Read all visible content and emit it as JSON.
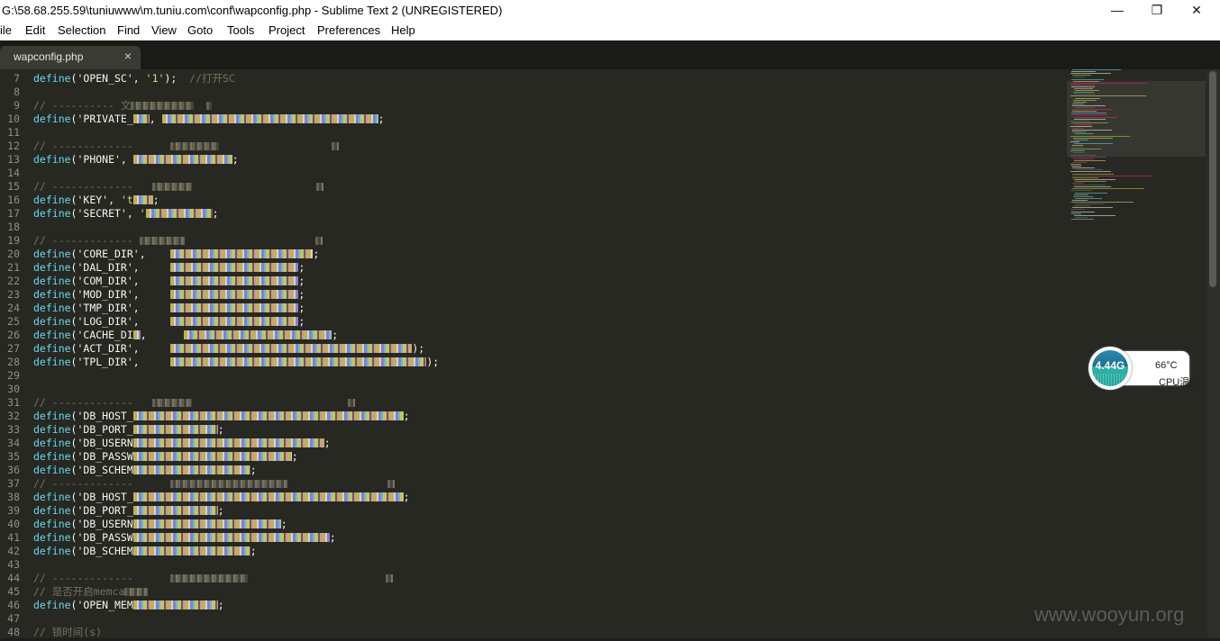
{
  "window": {
    "title": "G:\\58.68.255.59\\tuniuwww\\m.tuniu.com\\conf\\wapconfig.php - Sublime Text 2 (UNREGISTERED)",
    "minimize_icon": "minimize-icon",
    "maximize_icon": "restore-icon",
    "close_icon": "close-icon"
  },
  "menu": [
    "ile",
    "Edit",
    "Selection",
    "Find",
    "View",
    "Goto",
    "Tools",
    "Project",
    "Preferences",
    "Help"
  ],
  "tab": {
    "name": "wapconfig.php",
    "close": "×"
  },
  "lines": [
    {
      "n": "7",
      "parts": [
        [
          "kw",
          "define"
        ],
        [
          "pn",
          "('OPEN_SC'"
        ],
        [
          "pn",
          ", "
        ],
        [
          "st",
          "'1'"
        ],
        [
          "pn",
          ");  "
        ],
        [
          "cm",
          "//打开SC"
        ]
      ]
    },
    {
      "n": "8",
      "parts": []
    },
    {
      "n": "9",
      "parts": [
        [
          "cm",
          "// ---------- 文"
        ],
        [
          "dim",
          "70"
        ],
        [
          "cm",
          "  "
        ],
        [
          "dim",
          "6"
        ]
      ]
    },
    {
      "n": "10",
      "parts": [
        [
          "kw",
          "define"
        ],
        [
          "pn",
          "('PRIVATE_"
        ],
        [
          "blk",
          "18"
        ],
        [
          "pn",
          ", "
        ],
        [
          "blk",
          "240"
        ],
        [
          "pn",
          ";"
        ]
      ]
    },
    {
      "n": "11",
      "parts": []
    },
    {
      "n": "12",
      "parts": [
        [
          "cm",
          "// -------------      "
        ],
        [
          "dim",
          "54"
        ],
        [
          "cm",
          "                  "
        ],
        [
          "dim",
          "8"
        ]
      ]
    },
    {
      "n": "13",
      "parts": [
        [
          "kw",
          "define"
        ],
        [
          "pn",
          "('PHONE', "
        ],
        [
          "blk",
          "110"
        ],
        [
          "pn",
          ";"
        ]
      ]
    },
    {
      "n": "14",
      "parts": []
    },
    {
      "n": "15",
      "parts": [
        [
          "cm",
          "// -------------   "
        ],
        [
          "dim",
          "44"
        ],
        [
          "cm",
          "                    "
        ],
        [
          "dim",
          "8"
        ]
      ]
    },
    {
      "n": "16",
      "parts": [
        [
          "kw",
          "define"
        ],
        [
          "pn",
          "('KEY', "
        ],
        [
          "st",
          "'t"
        ],
        [
          "blk",
          "22"
        ],
        [
          "pn",
          ";"
        ]
      ]
    },
    {
      "n": "17",
      "parts": [
        [
          "kw",
          "define"
        ],
        [
          "pn",
          "('SECRET', "
        ],
        [
          "st",
          "'"
        ],
        [
          "blk",
          "74"
        ],
        [
          "pn",
          ";"
        ]
      ]
    },
    {
      "n": "18",
      "parts": []
    },
    {
      "n": "19",
      "parts": [
        [
          "cm",
          "// ------------- "
        ],
        [
          "dim",
          "50"
        ],
        [
          "cm",
          "                     "
        ],
        [
          "dim",
          "8"
        ]
      ]
    },
    {
      "n": "20",
      "parts": [
        [
          "kw",
          "define"
        ],
        [
          "pn",
          "('CORE_DIR'"
        ],
        [
          "pn",
          ",    "
        ],
        [
          "blk",
          "158"
        ],
        [
          "pn",
          ";"
        ]
      ]
    },
    {
      "n": "21",
      "parts": [
        [
          "kw",
          "define"
        ],
        [
          "pn",
          "('DAL_DIR'"
        ],
        [
          "pn",
          ",     "
        ],
        [
          "blk",
          "142"
        ],
        [
          "pn",
          ";"
        ]
      ]
    },
    {
      "n": "22",
      "parts": [
        [
          "kw",
          "define"
        ],
        [
          "pn",
          "('COM_DIR'"
        ],
        [
          "pn",
          ",     "
        ],
        [
          "blk",
          "142"
        ],
        [
          "pn",
          ";"
        ]
      ]
    },
    {
      "n": "23",
      "parts": [
        [
          "kw",
          "define"
        ],
        [
          "pn",
          "('MOD_DIR'"
        ],
        [
          "pn",
          ",     "
        ],
        [
          "blk",
          "142"
        ],
        [
          "pn",
          ";"
        ]
      ]
    },
    {
      "n": "24",
      "parts": [
        [
          "kw",
          "define"
        ],
        [
          "pn",
          "('TMP_DIR'"
        ],
        [
          "pn",
          ",     "
        ],
        [
          "blk",
          "142"
        ],
        [
          "pn",
          ";"
        ]
      ]
    },
    {
      "n": "25",
      "parts": [
        [
          "kw",
          "define"
        ],
        [
          "pn",
          "('LOG_DIR'"
        ],
        [
          "pn",
          ",     "
        ],
        [
          "blk",
          "142"
        ],
        [
          "pn",
          ";"
        ]
      ]
    },
    {
      "n": "26",
      "parts": [
        [
          "kw",
          "define"
        ],
        [
          "pn",
          "('CACHE_DI"
        ],
        [
          "blk",
          "8"
        ],
        [
          "pn",
          ",      "
        ],
        [
          "blk",
          "164"
        ],
        [
          "pn",
          ";"
        ]
      ]
    },
    {
      "n": "27",
      "parts": [
        [
          "kw",
          "define"
        ],
        [
          "pn",
          "('ACT_DIR'"
        ],
        [
          "pn",
          ",     "
        ],
        [
          "blk",
          "268"
        ],
        [
          "pn",
          ");"
        ]
      ]
    },
    {
      "n": "28",
      "parts": [
        [
          "kw",
          "define"
        ],
        [
          "pn",
          "('TPL_DIR'"
        ],
        [
          "pn",
          ",     "
        ],
        [
          "blk",
          "284"
        ],
        [
          "pn",
          ");"
        ]
      ]
    },
    {
      "n": "29",
      "parts": []
    },
    {
      "n": "30",
      "parts": []
    },
    {
      "n": "31",
      "parts": [
        [
          "cm",
          "// -------------   "
        ],
        [
          "dim",
          "44"
        ],
        [
          "cm",
          "                         "
        ],
        [
          "dim",
          "8"
        ]
      ]
    },
    {
      "n": "32",
      "parts": [
        [
          "kw",
          "define"
        ],
        [
          "pn",
          "('DB_HOST_"
        ],
        [
          "blk",
          "300"
        ],
        [
          "pn",
          ";"
        ]
      ]
    },
    {
      "n": "33",
      "parts": [
        [
          "kw",
          "define"
        ],
        [
          "pn",
          "('DB_PORT_"
        ],
        [
          "blk",
          "94"
        ],
        [
          "pn",
          ";"
        ]
      ]
    },
    {
      "n": "34",
      "parts": [
        [
          "kw",
          "define"
        ],
        [
          "pn",
          "('DB_USERN"
        ],
        [
          "blk",
          "212"
        ],
        [
          "pn",
          ";"
        ]
      ]
    },
    {
      "n": "35",
      "parts": [
        [
          "kw",
          "define"
        ],
        [
          "pn",
          "('DB_PASSW"
        ],
        [
          "blk",
          "176"
        ],
        [
          "pn",
          ";"
        ]
      ]
    },
    {
      "n": "36",
      "parts": [
        [
          "kw",
          "define"
        ],
        [
          "pn",
          "('DB_SCHEM"
        ],
        [
          "blk",
          "130"
        ],
        [
          "pn",
          ";"
        ]
      ]
    },
    {
      "n": "37",
      "parts": [
        [
          "cm",
          "// -------------      "
        ],
        [
          "dim",
          "130"
        ],
        [
          "cm",
          "                "
        ],
        [
          "dim",
          "8"
        ]
      ]
    },
    {
      "n": "38",
      "parts": [
        [
          "kw",
          "define"
        ],
        [
          "pn",
          "('DB_HOST_"
        ],
        [
          "blk",
          "300"
        ],
        [
          "pn",
          ";"
        ]
      ]
    },
    {
      "n": "39",
      "parts": [
        [
          "kw",
          "define"
        ],
        [
          "pn",
          "('DB_PORT_"
        ],
        [
          "blk",
          "94"
        ],
        [
          "pn",
          ";"
        ]
      ]
    },
    {
      "n": "40",
      "parts": [
        [
          "kw",
          "define"
        ],
        [
          "pn",
          "('DB_USERN"
        ],
        [
          "blk",
          "164"
        ],
        [
          "pn",
          ";"
        ]
      ]
    },
    {
      "n": "41",
      "parts": [
        [
          "kw",
          "define"
        ],
        [
          "pn",
          "('DB_PASSW"
        ],
        [
          "blk",
          "218"
        ],
        [
          "pn",
          ";"
        ]
      ]
    },
    {
      "n": "42",
      "parts": [
        [
          "kw",
          "define"
        ],
        [
          "pn",
          "('DB_SCHEM"
        ],
        [
          "blk",
          "130"
        ],
        [
          "pn",
          ";"
        ]
      ]
    },
    {
      "n": "43",
      "parts": []
    },
    {
      "n": "44",
      "parts": [
        [
          "cm",
          "// -------------      "
        ],
        [
          "dim",
          "86"
        ],
        [
          "cm",
          "                      "
        ],
        [
          "dim",
          "8"
        ]
      ]
    },
    {
      "n": "45",
      "parts": [
        [
          "cm",
          "// 是否开启memca"
        ],
        [
          "dim",
          "26"
        ]
      ]
    },
    {
      "n": "46",
      "parts": [
        [
          "kw",
          "define"
        ],
        [
          "pn",
          "('OPEN_MEM"
        ],
        [
          "blk",
          "94"
        ],
        [
          "pn",
          ";"
        ]
      ]
    },
    {
      "n": "47",
      "parts": []
    },
    {
      "n": "48",
      "parts": [
        [
          "cm",
          "// 锁时间(s)"
        ]
      ]
    }
  ],
  "cpu_widget": {
    "value": "4.44G",
    "temperature": "66°C",
    "label": "CPU温度"
  },
  "watermark": "www.wooyun.org",
  "colors": {
    "bg": "#272822",
    "keyword": "#66d9ef",
    "string": "#e6db74",
    "comment": "#75715e",
    "plain": "#f8f8f2"
  }
}
